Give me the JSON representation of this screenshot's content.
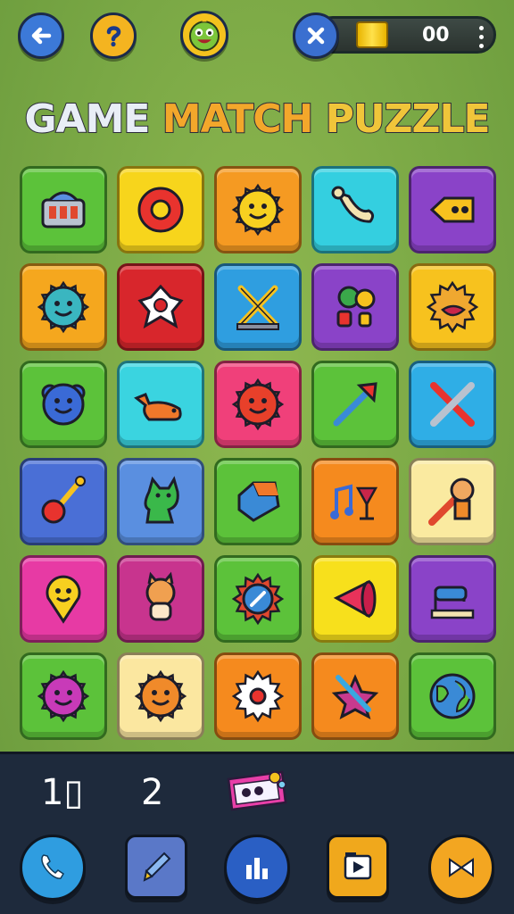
{
  "topbar": {
    "back_icon": "arrow-left-icon",
    "help_icon": "question-icon",
    "avatar_icon": "green-monster-avatar-icon",
    "close_icon": "close-x-icon",
    "coin_icon": "gold-bar-icon",
    "coins": "00",
    "menu_icon": "vertical-dots-icon"
  },
  "title": {
    "word1": "GAME",
    "word2": "MATCH",
    "word3": "PUZZLE"
  },
  "board": {
    "rows": 6,
    "cols": 5,
    "tiles": [
      {
        "icon": "robot-machine-icon",
        "color": "#5cc23a"
      },
      {
        "icon": "red-ring-icon",
        "color": "#f7d51c"
      },
      {
        "icon": "smiling-sun-icon",
        "color": "#f59a22"
      },
      {
        "icon": "bone-horn-icon",
        "color": "#34cfe0"
      },
      {
        "icon": "fish-toy-icon",
        "color": "#8a43c8"
      },
      {
        "icon": "smiling-gear-icon",
        "color": "#f5a71e"
      },
      {
        "icon": "white-star-icon",
        "color": "#d8262c"
      },
      {
        "icon": "crossed-tools-icon",
        "color": "#2f9ee0"
      },
      {
        "icon": "balloons-icon",
        "color": "#8a43c8"
      },
      {
        "icon": "cookie-monster-icon",
        "color": "#f7c21e"
      },
      {
        "icon": "blue-bear-icon",
        "color": "#5cc23a"
      },
      {
        "icon": "orange-dino-icon",
        "color": "#3ad4e0"
      },
      {
        "icon": "red-blob-icon",
        "color": "#f0407a"
      },
      {
        "icon": "arrow-icon",
        "color": "#5cc23a"
      },
      {
        "icon": "crossed-pencils-icon",
        "color": "#2faee6"
      },
      {
        "icon": "guitar-icon",
        "color": "#4a6fd6"
      },
      {
        "icon": "green-cat-icon",
        "color": "#5a8fe0"
      },
      {
        "icon": "blue-gem-icon",
        "color": "#5cc23a"
      },
      {
        "icon": "music-drink-icon",
        "color": "#f58a1e"
      },
      {
        "icon": "fox-pencil-icon",
        "color": "#faeaa0"
      },
      {
        "icon": "map-pin-face-icon",
        "color": "#e73aa4"
      },
      {
        "icon": "shiba-dog-icon",
        "color": "#c8348e"
      },
      {
        "icon": "compass-gear-icon",
        "color": "#5cc23a"
      },
      {
        "icon": "megaphone-icon",
        "color": "#f7e01c"
      },
      {
        "icon": "sewing-machine-icon",
        "color": "#8a43c8"
      },
      {
        "icon": "purple-flower-icon",
        "color": "#5cc23a"
      },
      {
        "icon": "orange-sun-face-icon",
        "color": "#fbe7a0"
      },
      {
        "icon": "white-gear-icon",
        "color": "#f58a1e"
      },
      {
        "icon": "paint-star-icon",
        "color": "#f58a1e"
      },
      {
        "icon": "earth-globe-icon",
        "color": "#5cc23a"
      }
    ]
  },
  "footer": {
    "stat_a": "1▯",
    "stat_b": "2",
    "ticket_icon": "ticket-icon",
    "buttons": [
      {
        "icon": "phone-icon"
      },
      {
        "icon": "paint-brush-icon"
      },
      {
        "icon": "bar-chart-icon"
      },
      {
        "icon": "video-icon"
      },
      {
        "icon": "swap-arrows-icon"
      }
    ]
  }
}
